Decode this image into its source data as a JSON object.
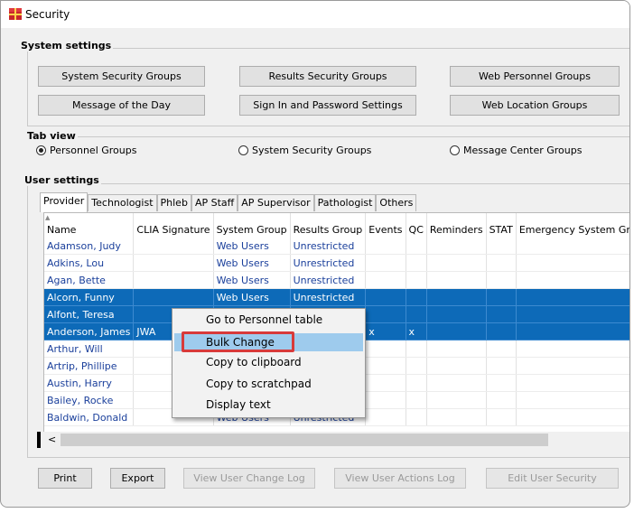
{
  "window": {
    "title": "Security",
    "icon": "security-app-icon",
    "accent": "#0d6ab8"
  },
  "system_settings": {
    "title": "System settings",
    "buttons": [
      "System Security Groups",
      "Results Security Groups",
      "Web Personnel Groups",
      "Message of the Day",
      "Sign In and Password Settings",
      "Web Location Groups"
    ]
  },
  "tab_view": {
    "title": "Tab view",
    "options": [
      "Personnel Groups",
      "System Security Groups",
      "Message Center Groups"
    ],
    "selected": "Personnel Groups"
  },
  "user_settings": {
    "title": "User settings",
    "tabs": [
      "Provider",
      "Technologist",
      "Phleb",
      "AP Staff",
      "AP Supervisor",
      "Pathologist",
      "Others"
    ],
    "active_tab": "Provider",
    "columns": [
      "Name",
      "CLIA Signature",
      "System Group",
      "Results Group",
      "Events",
      "QC",
      "Reminders",
      "STAT",
      "Emergency System Grou"
    ],
    "rows": [
      [
        "Adamson, Judy",
        "",
        "Web Users",
        "Unrestricted",
        "",
        "",
        "",
        "",
        ""
      ],
      [
        "Adkins, Lou",
        "",
        "Web Users",
        "Unrestricted",
        "",
        "",
        "",
        "",
        ""
      ],
      [
        "Agan, Bette",
        "",
        "Web Users",
        "Unrestricted",
        "",
        "",
        "",
        "",
        ""
      ],
      [
        "Alcorn, Funny",
        "",
        "Web Users",
        "Unrestricted",
        "",
        "",
        "",
        "",
        ""
      ],
      [
        "Alfont, Teresa",
        "",
        "",
        "",
        "",
        "",
        "",
        "",
        ""
      ],
      [
        "Anderson, James",
        "JWA",
        "",
        "",
        "x",
        "x",
        "",
        "",
        ""
      ],
      [
        "Arthur, Will",
        "",
        "",
        "",
        "",
        "",
        "",
        "",
        ""
      ],
      [
        "Artrip, Phillipe",
        "",
        "",
        "",
        "",
        "",
        "",
        "",
        ""
      ],
      [
        "Austin, Harry",
        "",
        "",
        "",
        "",
        "",
        "",
        "",
        ""
      ],
      [
        "Bailey, Rocke",
        "",
        "",
        "",
        "",
        "",
        "",
        "",
        ""
      ],
      [
        "Baldwin, Donald",
        "",
        "Web Users",
        "Unrestricted",
        "",
        "",
        "",
        "",
        ""
      ]
    ],
    "selected_rows": [
      "Alcorn, Funny",
      "Alfont, Teresa",
      "Anderson, James"
    ],
    "scroll_left_glyph": "<"
  },
  "context_menu": {
    "items": [
      "Go to Personnel table",
      "Bulk Change",
      "Copy to clipboard",
      "Copy to scratchpad",
      "Display text"
    ],
    "hovered": "Bulk Change",
    "highlight_color": "#d83a3a"
  },
  "footer": {
    "buttons": [
      "Print",
      "Export",
      "View User Change Log",
      "View User Actions Log",
      "Edit User Security"
    ],
    "disabled": [
      "View User Change Log",
      "View User Actions Log",
      "Edit User Security"
    ]
  }
}
